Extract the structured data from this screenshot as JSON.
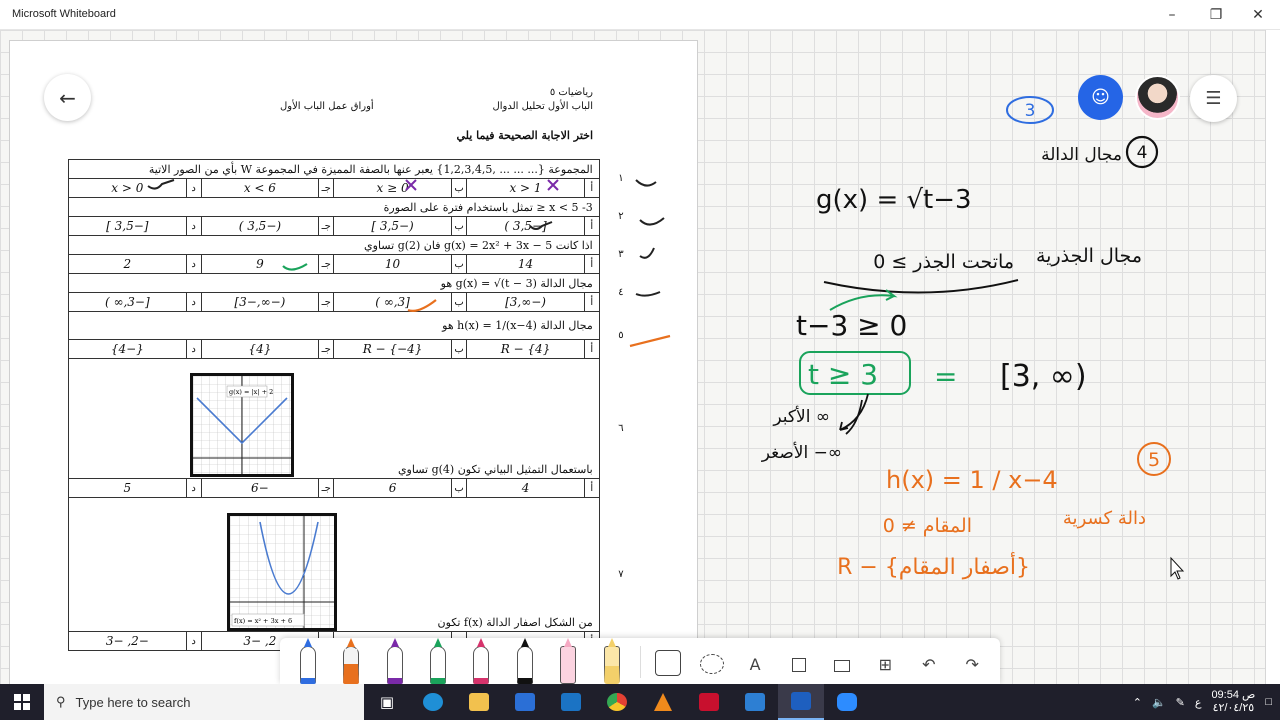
{
  "window": {
    "title": "Microsoft Whiteboard"
  },
  "sheet": {
    "header_right_1": "رياضيات ٥",
    "header_right_2": "الباب الأول تحليل الدوال",
    "header_left": "أوراق عمل الباب الأول",
    "instruction": "اختر الاجابة الصحيحة فيما يلي",
    "questions": [
      {
        "num": "١",
        "text": "المجموعة {... ... ... ,1,2,3,4,5} يعبر عنها بالصفة المميزة في المجموعة W بأي من الصور الاتية",
        "options": [
          {
            "letter": "أ",
            "value": "x > 1"
          },
          {
            "letter": "ب",
            "value": "x ≥ 0"
          },
          {
            "letter": "جـ",
            "value": "x < 6"
          },
          {
            "letter": "د",
            "value": "x > 0"
          }
        ]
      },
      {
        "num": "٢",
        "text": "x < 5  -3 ≤ تمثل باستخدام فترة على الصورة",
        "options": [
          {
            "letter": "أ",
            "value": "[−3,5 )"
          },
          {
            "letter": "ب",
            "value": "(−3,5 ]"
          },
          {
            "letter": "جـ",
            "value": "(−3,5 )"
          },
          {
            "letter": "د",
            "value": "[−3,5 ]"
          }
        ]
      },
      {
        "num": "٣",
        "text": "اذا كانت  g(x) = 2x² + 3x − 5  فان  g(2)  تساوي",
        "options": [
          {
            "letter": "أ",
            "value": "14"
          },
          {
            "letter": "ب",
            "value": "10"
          },
          {
            "letter": "جـ",
            "value": "9"
          },
          {
            "letter": "د",
            "value": "2"
          }
        ]
      },
      {
        "num": "٤",
        "text": "مجال الدالة  g(x) = √(t − 3)  هو",
        "options": [
          {
            "letter": "أ",
            "value": "(−∞,3]"
          },
          {
            "letter": "ب",
            "value": "[3,∞ )"
          },
          {
            "letter": "جـ",
            "value": "(−∞,−3]"
          },
          {
            "letter": "د",
            "value": "[−3,∞ )"
          }
        ]
      },
      {
        "num": "٥",
        "text": "مجال الدالة  h(x) = 1/(x−4)  هو",
        "options": [
          {
            "letter": "أ",
            "value": "R − {4}"
          },
          {
            "letter": "ب",
            "value": "R − {−4}"
          },
          {
            "letter": "جـ",
            "value": "{4}"
          },
          {
            "letter": "د",
            "value": "{−4}"
          }
        ]
      },
      {
        "num": "٦",
        "text": "باستعمال التمثيل البياني تكون  g(4)  تساوي",
        "graph_label": "g(x) = |x| + 2",
        "options": [
          {
            "letter": "أ",
            "value": "4"
          },
          {
            "letter": "ب",
            "value": "6"
          },
          {
            "letter": "جـ",
            "value": "−6"
          },
          {
            "letter": "د",
            "value": "5"
          }
        ]
      },
      {
        "num": "٧",
        "text": "من الشكل اصفار الدالة  f(x)  تكون",
        "graph_label": "f(x) = x² + 3x + 6",
        "options": [
          {
            "letter": "أ",
            "value": ""
          },
          {
            "letter": "ب",
            "value": ""
          },
          {
            "letter": "جـ",
            "value": "2, −3"
          },
          {
            "letter": "د",
            "value": "−2, −3"
          }
        ]
      }
    ]
  },
  "ink": {
    "circle_3": "3",
    "circle_4": "4",
    "domain_title": "مجال الدالة",
    "g_def": "g(x) = √t−3",
    "radical_domain": "مجال الجذرية",
    "radicand_rule": "ماتحت الجذر ≥ 0",
    "inequality": "t−3 ≥ 0",
    "result_interval": "t ≥ 3",
    "equals": "=",
    "interval": "[3, ∞)",
    "largest": "الأكبر ∞",
    "smallest": "الأصغر −∞",
    "circle_5": "5",
    "h_def": "h(x) = 1 / x−4",
    "rational_fn": "دالة كسرية",
    "denominator_rule": "المقام ≠ 0",
    "rational_domain": "R − {أصفار المقام}"
  },
  "toolbar": {
    "pens": [
      "blue-pen",
      "orange-pen",
      "purple-pen",
      "green-pen",
      "pink-pen",
      "black-pen",
      "highlighter-pink",
      "highlighter-yellow"
    ],
    "tools": [
      "ruler",
      "lasso",
      "text",
      "sticky-note",
      "image",
      "add",
      "undo",
      "redo"
    ],
    "text_glyph": "A"
  },
  "taskbar": {
    "search_placeholder": "Type here to search",
    "time": "09:54 ص",
    "date": "٤٢/٠٤/٢٥",
    "lang": "ع"
  }
}
